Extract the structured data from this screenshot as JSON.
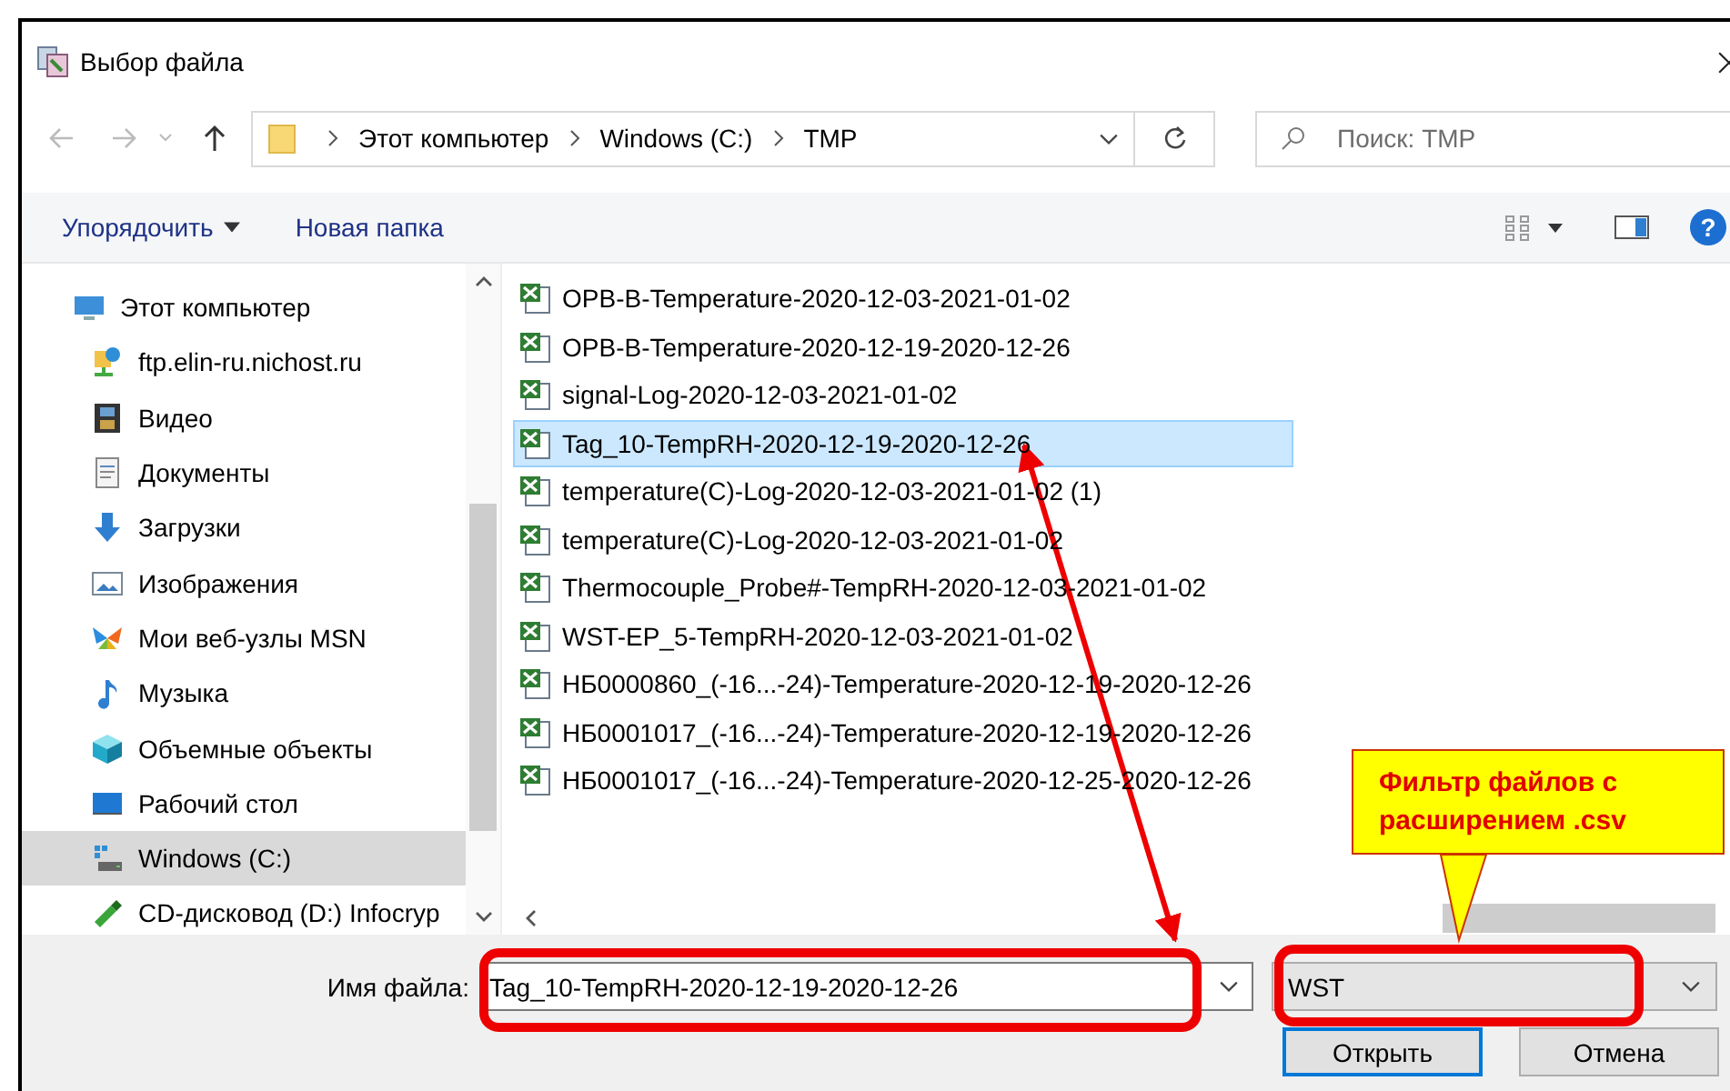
{
  "window": {
    "title": "Выбор файла"
  },
  "address": {
    "segments": [
      "Этот компьютер",
      "Windows (C:)",
      "TMP"
    ]
  },
  "search": {
    "placeholder": "Поиск: TMP"
  },
  "toolbar": {
    "organize": "Упорядочить",
    "new_folder": "Новая папка",
    "help": "?"
  },
  "sidebar": {
    "items": [
      {
        "label": "Этот компьютер",
        "selected": false,
        "children": [
          {
            "label": "ftp.elin-ru.nichost.ru",
            "selected": false
          },
          {
            "label": "Видео",
            "selected": false
          },
          {
            "label": "Документы",
            "selected": false
          },
          {
            "label": "Загрузки",
            "selected": false
          },
          {
            "label": "Изображения",
            "selected": false
          },
          {
            "label": "Мои веб-узлы MSN",
            "selected": false
          },
          {
            "label": "Музыка",
            "selected": false
          },
          {
            "label": "Объемные объекты",
            "selected": false
          },
          {
            "label": "Рабочий стол",
            "selected": false
          },
          {
            "label": "Windows (C:)",
            "selected": true
          },
          {
            "label": "CD-дисковод (D:) Infocryp",
            "selected": false
          }
        ]
      }
    ]
  },
  "files": [
    {
      "name": "OPB-B-Temperature-2020-12-03-2021-01-02",
      "selected": false
    },
    {
      "name": "OPB-B-Temperature-2020-12-19-2020-12-26",
      "selected": false
    },
    {
      "name": "signal-Log-2020-12-03-2021-01-02",
      "selected": false
    },
    {
      "name": "Tag_10-TempRH-2020-12-19-2020-12-26",
      "selected": true
    },
    {
      "name": "temperature(C)-Log-2020-12-03-2021-01-02 (1)",
      "selected": false
    },
    {
      "name": "temperature(C)-Log-2020-12-03-2021-01-02",
      "selected": false
    },
    {
      "name": "Thermocouple_Probe#-TempRH-2020-12-03-2021-01-02",
      "selected": false
    },
    {
      "name": "WST-EP_5-TempRH-2020-12-03-2021-01-02",
      "selected": false
    },
    {
      "name": "НБ0000860_(-16...-24)-Temperature-2020-12-19-2020-12-26",
      "selected": false
    },
    {
      "name": "НБ0001017_(-16...-24)-Temperature-2020-12-19-2020-12-26",
      "selected": false
    },
    {
      "name": "НБ0001017_(-16...-24)-Temperature-2020-12-25-2020-12-26",
      "selected": false
    }
  ],
  "file_name": {
    "label": "Имя файла:",
    "value": "Tag_10-TempRH-2020-12-19-2020-12-26"
  },
  "file_type": {
    "value": "WST"
  },
  "buttons": [
    "Открыть",
    "Отмена"
  ],
  "callout": {
    "text": "Фильтр файлов с расширением .csv"
  }
}
